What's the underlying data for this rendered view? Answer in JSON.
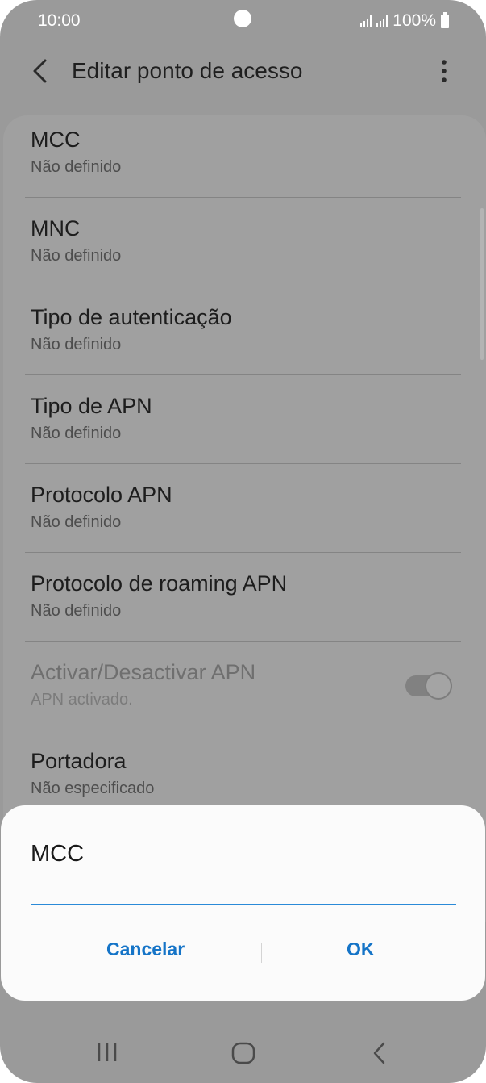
{
  "status_bar": {
    "time": "10:00",
    "battery": "100%"
  },
  "app_bar": {
    "title": "Editar ponto de acesso"
  },
  "settings": [
    {
      "title": "MCC",
      "subtitle": "Não definido"
    },
    {
      "title": "MNC",
      "subtitle": "Não definido"
    },
    {
      "title": "Tipo de autenticação",
      "subtitle": "Não definido"
    },
    {
      "title": "Tipo de APN",
      "subtitle": "Não definido"
    },
    {
      "title": "Protocolo APN",
      "subtitle": "Não definido"
    },
    {
      "title": "Protocolo de roaming APN",
      "subtitle": "Não definido"
    },
    {
      "title": "Activar/Desactivar APN",
      "subtitle": "APN activado.",
      "toggle_on": true,
      "disabled": true
    },
    {
      "title": "Portadora",
      "subtitle": "Não especificado"
    }
  ],
  "dialog": {
    "title": "MCC",
    "input_value": "",
    "cancel_label": "Cancelar",
    "ok_label": "OK"
  },
  "colors": {
    "accent": "#1574c7",
    "input_underline": "#2a8ad8",
    "dim_background": "#9a9a9a",
    "dialog_background": "#fbfbfb"
  },
  "icons": [
    "back-arrow-icon",
    "more-options-icon",
    "signal-icon",
    "battery-icon",
    "recent-apps-icon",
    "home-icon",
    "nav-back-icon"
  ]
}
